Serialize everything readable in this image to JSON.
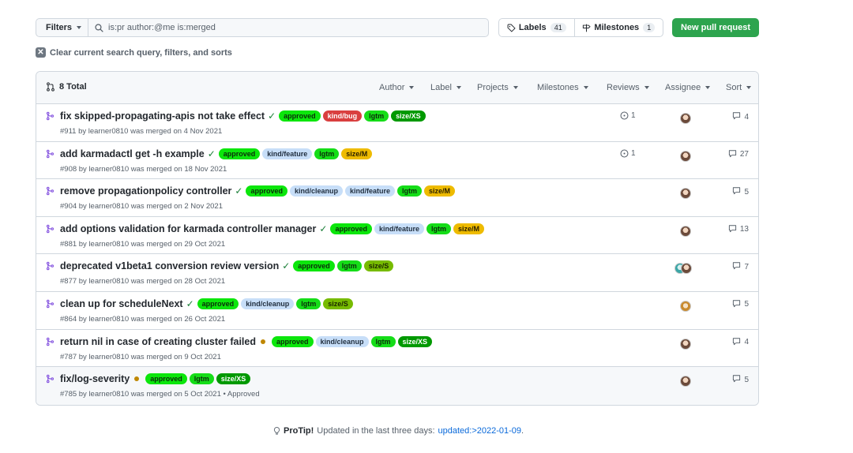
{
  "toolbar": {
    "filters_label": "Filters",
    "search_value": "is:pr author:@me is:merged",
    "labels_label": "Labels",
    "labels_count": "41",
    "milestones_label": "Milestones",
    "milestones_count": "1",
    "new_pr_label": "New pull request"
  },
  "clear_text": "Clear current search query, filters, and sorts",
  "header": {
    "total": "8 Total",
    "filters": [
      "Author",
      "Label",
      "Projects",
      "Milestones",
      "Reviews",
      "Assignee",
      "Sort"
    ]
  },
  "label_colors": {
    "approved": {
      "bg": "#0ce60c",
      "fg": "#0b2e0b"
    },
    "kind/bug": {
      "bg": "#d93f3f",
      "fg": "#ffffff"
    },
    "lgtm": {
      "bg": "#15dd18",
      "fg": "#0b2e0b"
    },
    "size/XS": {
      "bg": "#009900",
      "fg": "#ffffff"
    },
    "size/M": {
      "bg": "#eebb00",
      "fg": "#2b2000"
    },
    "size/S": {
      "bg": "#77bb00",
      "fg": "#1a2600"
    },
    "kind/feature": {
      "bg": "#c7def8",
      "fg": "#1f2d3d"
    },
    "kind/cleanup": {
      "bg": "#c7def8",
      "fg": "#1f2d3d"
    }
  },
  "rows": [
    {
      "title": "fix skipped-propagating-apis not take effect",
      "status": "check",
      "labels": [
        "approved",
        "kind/bug",
        "lgtm",
        "size/XS"
      ],
      "meta": "#911 by learner0810 was merged on 4 Nov 2021",
      "review": "1",
      "avatar": "single",
      "comments": "4"
    },
    {
      "title": "add karmadactl get -h example",
      "status": "check",
      "labels": [
        "approved",
        "kind/feature",
        "lgtm",
        "size/M"
      ],
      "meta": "#908 by learner0810 was merged on 18 Nov 2021",
      "review": "1",
      "avatar": "single",
      "comments": "27"
    },
    {
      "title": "remove propagationpolicy controller",
      "status": "check",
      "labels": [
        "approved",
        "kind/cleanup",
        "kind/feature",
        "lgtm",
        "size/M"
      ],
      "meta": "#904 by learner0810 was merged on 2 Nov 2021",
      "review": "",
      "avatar": "single",
      "comments": "5"
    },
    {
      "title": "add options validation for karmada controller manager",
      "status": "check",
      "labels": [
        "approved",
        "kind/feature",
        "lgtm",
        "size/M"
      ],
      "meta": "#881 by learner0810 was merged on 29 Oct 2021",
      "review": "",
      "avatar": "single",
      "comments": "13"
    },
    {
      "title": "deprecated v1beta1 conversion review version",
      "status": "check",
      "labels": [
        "approved",
        "lgtm",
        "size/S"
      ],
      "meta": "#877 by learner0810 was merged on 28 Oct 2021",
      "review": "",
      "avatar": "multi",
      "comments": "7"
    },
    {
      "title": "clean up for scheduleNext",
      "status": "check",
      "labels": [
        "approved",
        "kind/cleanup",
        "lgtm",
        "size/S"
      ],
      "meta": "#864 by learner0810 was merged on 26 Oct 2021",
      "review": "",
      "avatar": "orange",
      "comments": "5"
    },
    {
      "title": "return nil in case of creating cluster failed",
      "status": "pending",
      "labels": [
        "approved",
        "kind/cleanup",
        "lgtm",
        "size/XS"
      ],
      "meta": "#787 by learner0810 was merged on 9 Oct 2021",
      "review": "",
      "avatar": "single",
      "comments": "4"
    },
    {
      "title": "fix/log-severity",
      "status": "pending",
      "labels": [
        "approved",
        "lgtm",
        "size/XS"
      ],
      "meta": "#785 by learner0810 was merged on 5 Oct 2021 • Approved",
      "review": "",
      "avatar": "single",
      "comments": "5"
    }
  ],
  "protip": {
    "lead": "ProTip!",
    "text": "Updated in the last three days:",
    "link": "updated:>2022-01-09",
    "trail": "."
  },
  "icons": {
    "pr_merged": "git-merge-icon",
    "review": "circle-dot-icon",
    "comment": "comment-icon",
    "search": "search-icon",
    "tag": "tag-icon",
    "milestone": "milestone-icon",
    "bulb": "lightbulb-icon"
  }
}
